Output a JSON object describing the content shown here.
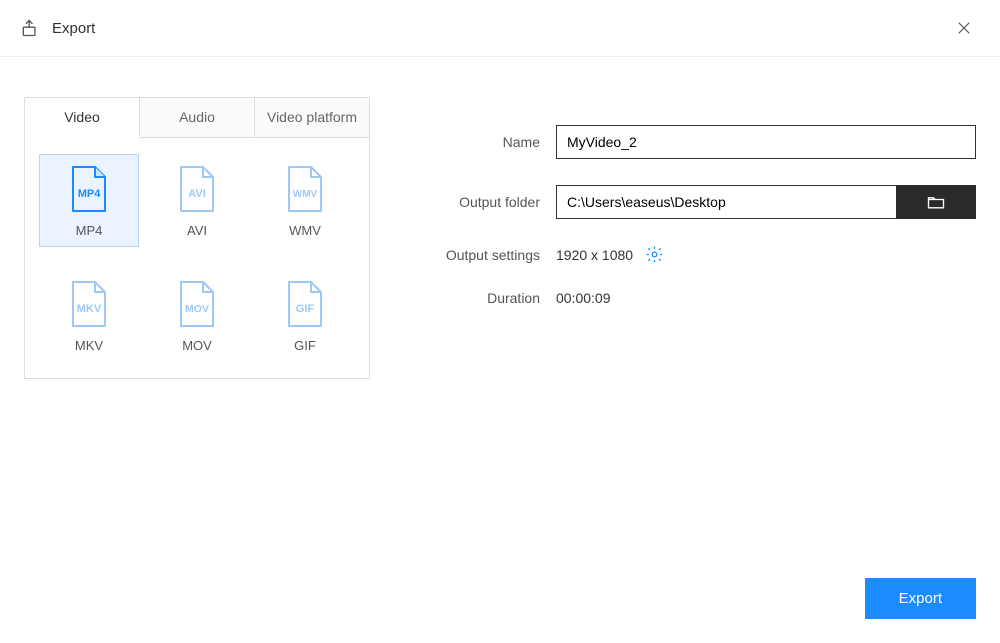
{
  "header": {
    "title": "Export"
  },
  "tabs": [
    {
      "label": "Video"
    },
    {
      "label": "Audio"
    },
    {
      "label": "Video platform"
    }
  ],
  "formats": [
    {
      "code": "MP4",
      "label": "MP4",
      "selected": true
    },
    {
      "code": "AVI",
      "label": "AVI",
      "selected": false
    },
    {
      "code": "WMV",
      "label": "WMV",
      "selected": false
    },
    {
      "code": "MKV",
      "label": "MKV",
      "selected": false
    },
    {
      "code": "MOV",
      "label": "MOV",
      "selected": false
    },
    {
      "code": "GIF",
      "label": "GIF",
      "selected": false
    }
  ],
  "form": {
    "name_label": "Name",
    "name_value": "MyVideo_2",
    "folder_label": "Output folder",
    "folder_value": "C:\\Users\\easeus\\Desktop",
    "settings_label": "Output settings",
    "settings_value": "1920 x 1080",
    "duration_label": "Duration",
    "duration_value": "00:00:09"
  },
  "footer": {
    "export_label": "Export"
  }
}
